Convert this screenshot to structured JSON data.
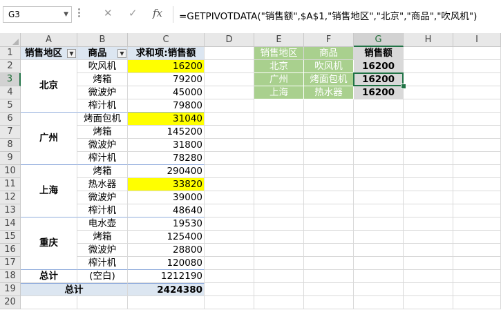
{
  "namebox": {
    "value": "G3"
  },
  "formula_bar": {
    "fx": "fx",
    "cancel": "✕",
    "enter": "✓",
    "formula": "=GETPIVOTDATA(\"销售额\",$A$1,\"销售地区\",\"北京\",\"商品\",\"吹风机\")"
  },
  "columns": [
    "A",
    "B",
    "C",
    "D",
    "E",
    "F",
    "G",
    "H",
    "I"
  ],
  "rows": [
    "1",
    "2",
    "3",
    "4",
    "5",
    "6",
    "7",
    "8",
    "9",
    "10",
    "11",
    "12",
    "13",
    "14",
    "15",
    "16",
    "17",
    "18",
    "19",
    "20"
  ],
  "pivot": {
    "headers": {
      "region": "销售地区",
      "product": "商品",
      "sum": "求和项:销售额"
    },
    "groups": [
      {
        "region": "北京",
        "items": [
          {
            "product": "吹风机",
            "value": "16200"
          },
          {
            "product": "烤箱",
            "value": "79200"
          },
          {
            "product": "微波炉",
            "value": "45000"
          },
          {
            "product": "榨汁机",
            "value": "79800"
          }
        ]
      },
      {
        "region": "广州",
        "items": [
          {
            "product": "烤面包机",
            "value": "31040"
          },
          {
            "product": "烤箱",
            "value": "145200"
          },
          {
            "product": "微波炉",
            "value": "31800"
          },
          {
            "product": "榨汁机",
            "value": "78280"
          }
        ]
      },
      {
        "region": "上海",
        "items": [
          {
            "product": "烤箱",
            "value": "290400"
          },
          {
            "product": "热水器",
            "value": "33820"
          },
          {
            "product": "微波炉",
            "value": "39000"
          },
          {
            "product": "榨汁机",
            "value": "48640"
          }
        ]
      },
      {
        "region": "重庆",
        "items": [
          {
            "product": "电水壶",
            "value": "19530"
          },
          {
            "product": "烤箱",
            "value": "125400"
          },
          {
            "product": "微波炉",
            "value": "28800"
          },
          {
            "product": "榨汁机",
            "value": "120080"
          }
        ]
      }
    ],
    "subtotal": {
      "label": "总计",
      "product": "(空白)",
      "value": "1212190"
    },
    "grand_total": {
      "label": "总计",
      "value": "2424380"
    }
  },
  "lookup": {
    "headers": [
      "销售地区",
      "商品",
      "销售额"
    ],
    "rows": [
      [
        "北京",
        "吹风机",
        "16200"
      ],
      [
        "广州",
        "烤面包机",
        "16200"
      ],
      [
        "上海",
        "热水器",
        "16200"
      ]
    ]
  },
  "colors": {
    "pivot_header_blue": "#dce6f1",
    "highlight_yellow": "#ffff00",
    "lookup_green": "#a9d08e",
    "lookup_gray": "#d9d9d9",
    "selection_green": "#217346"
  }
}
